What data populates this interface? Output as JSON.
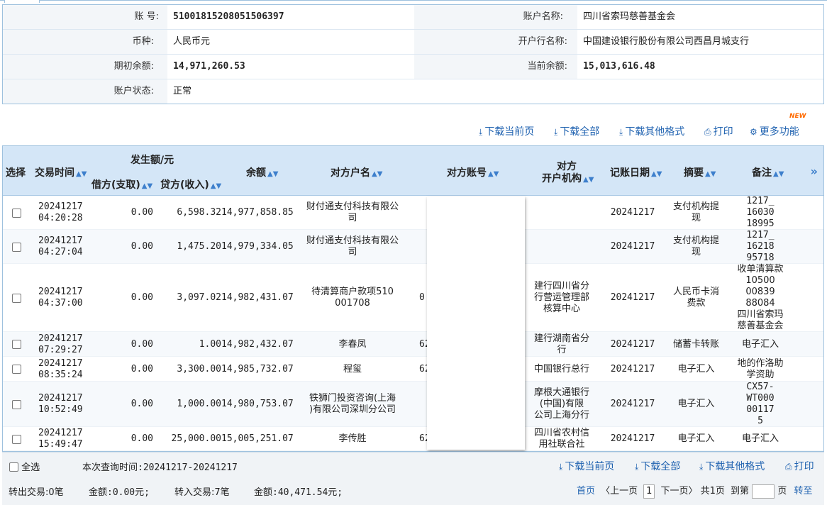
{
  "account": {
    "account_no_label": "账        号:",
    "account_no": "51001815208051506397",
    "account_name_label": "账户名称:",
    "account_name": "四川省索玛慈善基金会",
    "currency_label": "币种:",
    "currency": "人民币元",
    "bank_label": "开户行名称:",
    "bank": "中国建设银行股份有限公司西昌月城支行",
    "opening_balance_label": "期初余额:",
    "opening_balance": "14,971,260.53",
    "current_balance_label": "当前余额:",
    "current_balance": "15,013,616.48",
    "status_label": "账户状态:",
    "status": "正常"
  },
  "toolbar": {
    "download_page": "下载当前页",
    "download_all": "下载全部",
    "download_other": "下载其他格式",
    "print": "打印",
    "more": "更多功能",
    "new_badge": "NEW"
  },
  "table": {
    "headers": {
      "select": "选择",
      "time": "交易时间",
      "amount_group": "发生额/元",
      "debit": "借方(支取)",
      "credit": "贷方(收入)",
      "balance": "余额",
      "counterparty_name": "对方户名",
      "counterparty_account": "对方账号",
      "counterparty_bank_1": "对方",
      "counterparty_bank_2": "开户机构",
      "post_date": "记账日期",
      "summary": "摘要",
      "remark": "备注"
    },
    "rows": [
      {
        "date": "20241217",
        "time": "04:20:28",
        "debit": "0.00",
        "credit": "6,598.32",
        "balance": "14,977,858.85",
        "name_lines": [
          "财付通支付科技有限公",
          "司"
        ],
        "acct": "",
        "bank_lines": [],
        "post_date": "20241217",
        "summary_lines": [
          "支付机构提",
          "现"
        ],
        "remark_lines": [
          "1217_",
          "16030",
          "18995"
        ]
      },
      {
        "date": "20241217",
        "time": "04:27:04",
        "debit": "0.00",
        "credit": "1,475.20",
        "balance": "14,979,334.05",
        "name_lines": [
          "财付通支付科技有限公",
          "司"
        ],
        "acct": "",
        "bank_lines": [],
        "post_date": "20241217",
        "summary_lines": [
          "支付机构提",
          "现"
        ],
        "remark_lines": [
          "1217_",
          "16218",
          "95718"
        ]
      },
      {
        "date": "20241217",
        "time": "04:37:00",
        "debit": "0.00",
        "credit": "3,097.02",
        "balance": "14,982,431.07",
        "name_lines": [
          "待清算商户款项510",
          "001708"
        ],
        "acct": "0",
        "bank_lines": [
          "建行四川省分",
          "行营运管理部",
          "核算中心"
        ],
        "post_date": "20241217",
        "summary_lines": [
          "人民币卡消",
          "费款"
        ],
        "remark_lines": [
          "收单清算款",
          "10500",
          "00839",
          "88084",
          "四川省索玛",
          "慈善基金会"
        ]
      },
      {
        "date": "20241217",
        "time": "07:29:27",
        "debit": "0.00",
        "credit": "1.00",
        "balance": "14,982,432.07",
        "name_lines": [
          "李春凤"
        ],
        "acct": "62",
        "bank_lines": [
          "建行湖南省分",
          "行"
        ],
        "post_date": "20241217",
        "summary_lines": [
          "储蓄卡转账"
        ],
        "remark_lines": [
          "电子汇入"
        ]
      },
      {
        "date": "20241217",
        "time": "08:35:24",
        "debit": "0.00",
        "credit": "3,300.00",
        "balance": "14,985,732.07",
        "name_lines": [
          "程玺"
        ],
        "acct": "62",
        "bank_lines": [
          "中国银行总行"
        ],
        "post_date": "20241217",
        "summary_lines": [
          "电子汇入"
        ],
        "remark_lines": [
          "地的作洛助",
          "学资助"
        ]
      },
      {
        "date": "20241217",
        "time": "10:52:49",
        "debit": "0.00",
        "credit": "1,000.00",
        "balance": "14,980,753.07",
        "name_lines": [
          "铁狮门投资咨询(上海",
          ")有限公司深圳分公司"
        ],
        "acct": "",
        "bank_lines": [
          "摩根大通银行",
          "(中国)有限",
          "公司上海分行"
        ],
        "post_date": "20241217",
        "summary_lines": [
          "电子汇入"
        ],
        "remark_lines": [
          "CX57-",
          "WT000",
          "00117",
          "5"
        ]
      },
      {
        "date": "20241217",
        "time": "15:49:47",
        "debit": "0.00",
        "credit": "25,000.00",
        "balance": "15,005,251.07",
        "name_lines": [
          "李传胜"
        ],
        "acct": "62",
        "bank_lines": [
          "四川省农村信",
          "用社联合社"
        ],
        "post_date": "20241217",
        "summary_lines": [
          "电子汇入"
        ],
        "remark_lines": [
          "电子汇入"
        ]
      }
    ]
  },
  "footer": {
    "select_all": "全选",
    "query_time": "本次查询时间:20241217-20241217",
    "download_page": "下载当前页",
    "download_all": "下载全部",
    "download_other": "下载其他格式",
    "print": "打印",
    "out_txn": "转出交易:0笔",
    "out_amount": "金额:0.00元;",
    "in_txn": "转入交易:7笔",
    "in_amount": "金额:40,471.54元;",
    "first": "首页",
    "prev": "〈上一页",
    "page": "1",
    "next": "下一页〉",
    "total": "共1页",
    "goto_label": "到第",
    "page_unit": "页",
    "go": "转至"
  },
  "colors": {
    "link": "#1f62b0",
    "header_bg": "#d4e6f7",
    "border": "#9ec1de",
    "new_badge": "#ff6a00"
  }
}
